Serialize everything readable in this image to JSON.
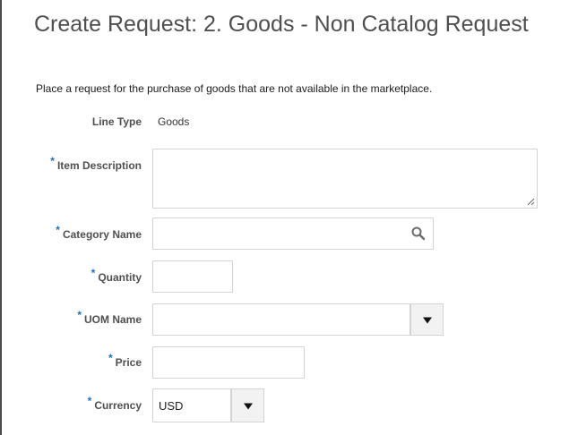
{
  "page": {
    "title": "Create Request: 2. Goods - Non Catalog Request",
    "intro": "Place a request for the purchase of goods that are not available in the marketplace."
  },
  "form": {
    "required_marker": "*",
    "line_type": {
      "label": "Line Type",
      "value": "Goods"
    },
    "item_description": {
      "label": "Item Description",
      "value": ""
    },
    "category_name": {
      "label": "Category Name",
      "value": "",
      "icon": "search-icon"
    },
    "quantity": {
      "label": "Quantity",
      "value": ""
    },
    "uom_name": {
      "label": "UOM Name",
      "value": "",
      "icon": "chevron-down-icon"
    },
    "price": {
      "label": "Price",
      "value": ""
    },
    "currency": {
      "label": "Currency",
      "value": "USD",
      "icon": "chevron-down-icon"
    }
  },
  "colors": {
    "required": "#1f6fb5",
    "label": "#4f4f4f",
    "field_border": "#d3d3d3",
    "dropdown_bg": "#f2f2f2"
  }
}
